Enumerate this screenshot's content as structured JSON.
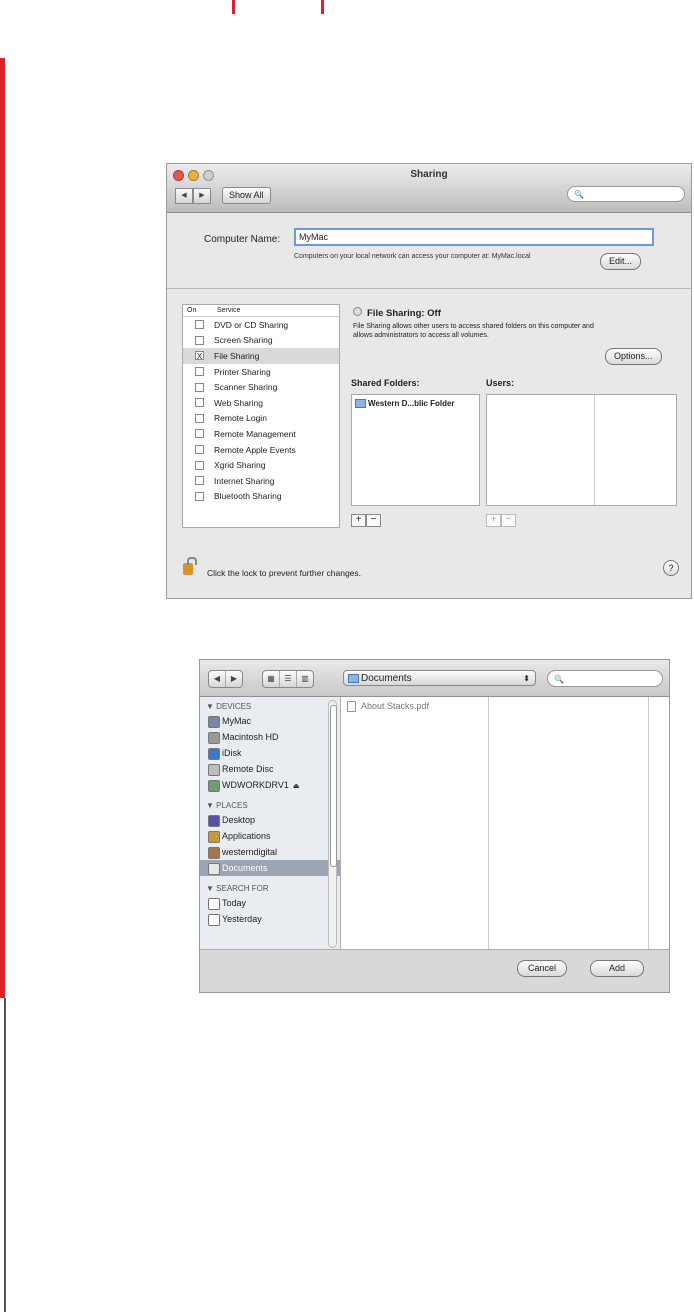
{
  "colors": {
    "accent_red": "#e0202a",
    "focus_blue": "#6d9ad6",
    "selected_row": "#9aa6b4"
  },
  "sharing_window": {
    "title": "Sharing",
    "nav_back": "◀",
    "nav_forward": "▶",
    "show_all": "Show All",
    "search_glyph": "🔍",
    "computer_name_label": "Computer Name:",
    "computer_name_value": "MyMac",
    "computer_name_hint": "Computers on your local network can access your computer at: MyMac.local",
    "edit_button": "Edit...",
    "service_header_on": "On",
    "service_header_service": "Service",
    "services": [
      {
        "label": "DVD or CD Sharing",
        "checked": ""
      },
      {
        "label": "Screen Sharing",
        "checked": ""
      },
      {
        "label": "File Sharing",
        "checked": "X"
      },
      {
        "label": "Printer Sharing",
        "checked": ""
      },
      {
        "label": "Scanner Sharing",
        "checked": ""
      },
      {
        "label": "Web Sharing",
        "checked": ""
      },
      {
        "label": "Remote Login",
        "checked": ""
      },
      {
        "label": "Remote Management",
        "checked": ""
      },
      {
        "label": "Remote Apple Events",
        "checked": ""
      },
      {
        "label": "Xgrid Sharing",
        "checked": ""
      },
      {
        "label": "Internet Sharing",
        "checked": ""
      },
      {
        "label": "Bluetooth Sharing",
        "checked": ""
      }
    ],
    "file_sharing_status": "File Sharing: Off",
    "file_sharing_desc": "File Sharing allows other users to access shared folders on this computer and allows administrators to access all volumes.",
    "options_button": "Options...",
    "shared_folders_label": "Shared Folders:",
    "shared_folder_item": "Western D...blic Folder",
    "users_label": "Users:",
    "plus": "+",
    "minus": "−",
    "lock_text": "Click the lock to prevent further changes.",
    "help": "?"
  },
  "open_dialog": {
    "nav_back": "◀",
    "nav_forward": "▶",
    "view_icons": "▦",
    "view_list": "☰",
    "view_columns": "▥",
    "location": "Documents",
    "location_arrows": "⬍",
    "search_glyph": "🔍",
    "devices_header": "▼ DEVICES",
    "devices": [
      "MyMac",
      "Macintosh HD",
      "iDisk",
      "Remote Disc",
      "WDWORKDRV1"
    ],
    "eject": "⏏",
    "places_header": "▼ PLACES",
    "places": [
      "Desktop",
      "Applications",
      "westerndigital",
      "Documents"
    ],
    "search_header": "▼ SEARCH FOR",
    "searches": [
      "Today",
      "Yesterday"
    ],
    "file": "About Stacks.pdf",
    "cancel_button": "Cancel",
    "add_button": "Add"
  }
}
